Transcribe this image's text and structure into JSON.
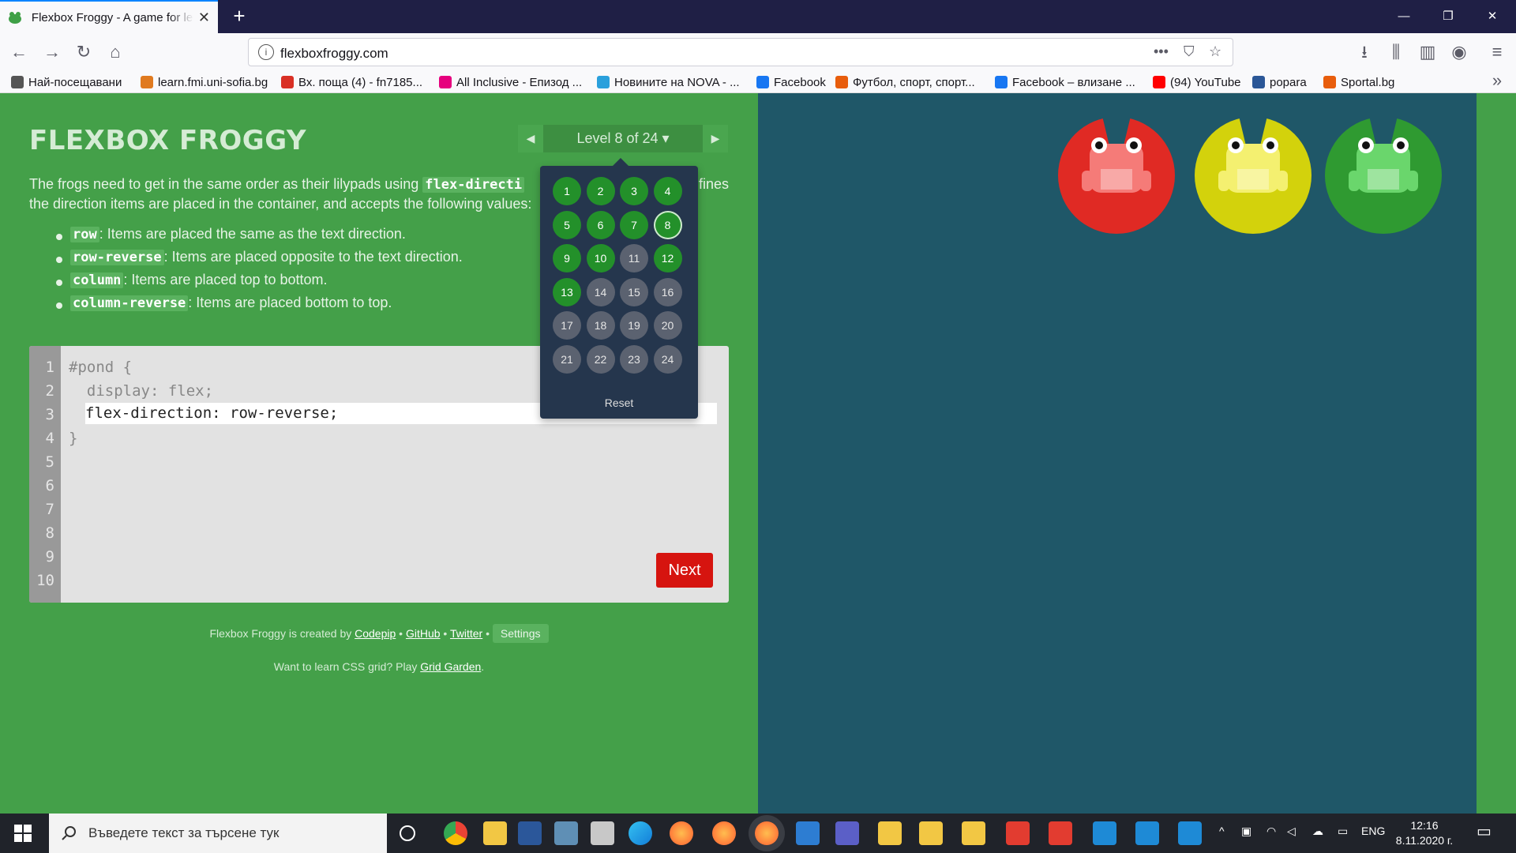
{
  "browser": {
    "tab_title": "Flexbox Froggy - A game for le",
    "new_tab": "+",
    "url": "flexboxfroggy.com",
    "window_controls": {
      "minimize": "—",
      "restore": "❐",
      "close": "✕"
    }
  },
  "bookmarks": [
    {
      "label": "Най-посещавани",
      "icon": "gear-icon",
      "color": "#555555"
    },
    {
      "label": "learn.fmi.uni-sofia.bg",
      "icon": "learn-icon",
      "color": "#e07a1f"
    },
    {
      "label": "Вх. поща (4) - fn7185...",
      "icon": "gmail-icon",
      "color": "#d93025"
    },
    {
      "label": "All Inclusive - Епизод ...",
      "icon": "seven-icon",
      "color": "#e6007e"
    },
    {
      "label": "Новините на NOVA - ...",
      "icon": "nova-icon",
      "color": "#2aa0dc"
    },
    {
      "label": "Facebook",
      "icon": "facebook-icon",
      "color": "#1877f2"
    },
    {
      "label": "Футбол, спорт, спорт...",
      "icon": "sport-icon",
      "color": "#e85d0c"
    },
    {
      "label": "Facebook – влизане ...",
      "icon": "facebook-icon",
      "color": "#1877f2"
    },
    {
      "label": "(94) YouTube",
      "icon": "youtube-icon",
      "color": "#ff0000"
    },
    {
      "label": "popara",
      "icon": "bowl-icon",
      "color": "#2b5797"
    },
    {
      "label": "Sportal.bg",
      "icon": "sportal-icon",
      "color": "#e85d0c"
    }
  ],
  "game": {
    "title": "FLEXBOX FROGGY",
    "level_label": "Level 8 of 24 ▾",
    "prev": "◀",
    "next_arrow": "▶",
    "description_1": "The frogs need to get in the same order as their lilypads using ",
    "description_code": "flex-directi",
    "description_2": "fines",
    "description_3": "the direction items are placed in the container, and accepts the following values:",
    "values": [
      {
        "code": "row",
        "text": ": Items are placed the same as the text direction."
      },
      {
        "code": "row-reverse",
        "text": ": Items are placed opposite to the text direction."
      },
      {
        "code": "column",
        "text": ": Items are placed top to bottom."
      },
      {
        "code": "column-reverse",
        "text": ": Items are placed bottom to top."
      }
    ],
    "line_numbers": [
      "1",
      "2",
      "3",
      "4",
      "5",
      "6",
      "7",
      "8",
      "9",
      "10"
    ],
    "code_lines": [
      "#pond {",
      "  display: flex;",
      "",
      "}"
    ],
    "answer": "flex-direction: row-reverse;",
    "next_button": "Next",
    "levels": [
      {
        "n": "1",
        "state": "done"
      },
      {
        "n": "2",
        "state": "done"
      },
      {
        "n": "3",
        "state": "done"
      },
      {
        "n": "4",
        "state": "done"
      },
      {
        "n": "5",
        "state": "done"
      },
      {
        "n": "6",
        "state": "done"
      },
      {
        "n": "7",
        "state": "done"
      },
      {
        "n": "8",
        "state": "current"
      },
      {
        "n": "9",
        "state": "done"
      },
      {
        "n": "10",
        "state": "done"
      },
      {
        "n": "11",
        "state": "todo"
      },
      {
        "n": "12",
        "state": "done"
      },
      {
        "n": "13",
        "state": "done"
      },
      {
        "n": "14",
        "state": "todo"
      },
      {
        "n": "15",
        "state": "todo"
      },
      {
        "n": "16",
        "state": "todo"
      },
      {
        "n": "17",
        "state": "todo"
      },
      {
        "n": "18",
        "state": "todo"
      },
      {
        "n": "19",
        "state": "todo"
      },
      {
        "n": "20",
        "state": "todo"
      },
      {
        "n": "21",
        "state": "todo"
      },
      {
        "n": "22",
        "state": "todo"
      },
      {
        "n": "23",
        "state": "todo"
      },
      {
        "n": "24",
        "state": "todo"
      }
    ],
    "reset": "Reset",
    "credits_pre": "Flexbox Froggy is created by ",
    "credits_codepip": "Codepip",
    "credits_github": "GitHub",
    "credits_twitter": "Twitter",
    "credits_sep": " • ",
    "settings": "Settings",
    "grid_pre": "Want to learn CSS grid? Play ",
    "grid_link": "Grid Garden",
    "grid_post": ".",
    "pads": [
      {
        "color": "red",
        "pad": "#e02a24",
        "frog": "#f57b78"
      },
      {
        "color": "yellow",
        "pad": "#d3d20c",
        "frog": "#f4f070"
      },
      {
        "color": "green",
        "pad": "#2f9a31",
        "frog": "#6ad66c"
      }
    ]
  },
  "taskbar": {
    "search_placeholder": "Въведете текст за търсене тук",
    "language": "ENG",
    "time": "12:16",
    "date": "8.11.2020 г."
  }
}
